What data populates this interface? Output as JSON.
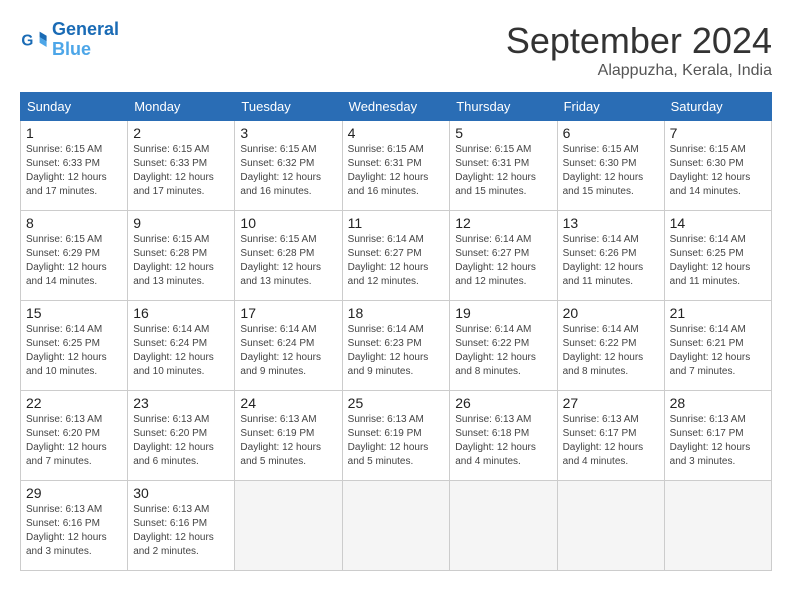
{
  "header": {
    "logo_line1": "General",
    "logo_line2": "Blue",
    "month": "September 2024",
    "location": "Alappuzha, Kerala, India"
  },
  "weekdays": [
    "Sunday",
    "Monday",
    "Tuesday",
    "Wednesday",
    "Thursday",
    "Friday",
    "Saturday"
  ],
  "weeks": [
    [
      {
        "day": "1",
        "info": "Sunrise: 6:15 AM\nSunset: 6:33 PM\nDaylight: 12 hours\nand 17 minutes."
      },
      {
        "day": "2",
        "info": "Sunrise: 6:15 AM\nSunset: 6:33 PM\nDaylight: 12 hours\nand 17 minutes."
      },
      {
        "day": "3",
        "info": "Sunrise: 6:15 AM\nSunset: 6:32 PM\nDaylight: 12 hours\nand 16 minutes."
      },
      {
        "day": "4",
        "info": "Sunrise: 6:15 AM\nSunset: 6:31 PM\nDaylight: 12 hours\nand 16 minutes."
      },
      {
        "day": "5",
        "info": "Sunrise: 6:15 AM\nSunset: 6:31 PM\nDaylight: 12 hours\nand 15 minutes."
      },
      {
        "day": "6",
        "info": "Sunrise: 6:15 AM\nSunset: 6:30 PM\nDaylight: 12 hours\nand 15 minutes."
      },
      {
        "day": "7",
        "info": "Sunrise: 6:15 AM\nSunset: 6:30 PM\nDaylight: 12 hours\nand 14 minutes."
      }
    ],
    [
      {
        "day": "8",
        "info": "Sunrise: 6:15 AM\nSunset: 6:29 PM\nDaylight: 12 hours\nand 14 minutes."
      },
      {
        "day": "9",
        "info": "Sunrise: 6:15 AM\nSunset: 6:28 PM\nDaylight: 12 hours\nand 13 minutes."
      },
      {
        "day": "10",
        "info": "Sunrise: 6:15 AM\nSunset: 6:28 PM\nDaylight: 12 hours\nand 13 minutes."
      },
      {
        "day": "11",
        "info": "Sunrise: 6:14 AM\nSunset: 6:27 PM\nDaylight: 12 hours\nand 12 minutes."
      },
      {
        "day": "12",
        "info": "Sunrise: 6:14 AM\nSunset: 6:27 PM\nDaylight: 12 hours\nand 12 minutes."
      },
      {
        "day": "13",
        "info": "Sunrise: 6:14 AM\nSunset: 6:26 PM\nDaylight: 12 hours\nand 11 minutes."
      },
      {
        "day": "14",
        "info": "Sunrise: 6:14 AM\nSunset: 6:25 PM\nDaylight: 12 hours\nand 11 minutes."
      }
    ],
    [
      {
        "day": "15",
        "info": "Sunrise: 6:14 AM\nSunset: 6:25 PM\nDaylight: 12 hours\nand 10 minutes."
      },
      {
        "day": "16",
        "info": "Sunrise: 6:14 AM\nSunset: 6:24 PM\nDaylight: 12 hours\nand 10 minutes."
      },
      {
        "day": "17",
        "info": "Sunrise: 6:14 AM\nSunset: 6:24 PM\nDaylight: 12 hours\nand 9 minutes."
      },
      {
        "day": "18",
        "info": "Sunrise: 6:14 AM\nSunset: 6:23 PM\nDaylight: 12 hours\nand 9 minutes."
      },
      {
        "day": "19",
        "info": "Sunrise: 6:14 AM\nSunset: 6:22 PM\nDaylight: 12 hours\nand 8 minutes."
      },
      {
        "day": "20",
        "info": "Sunrise: 6:14 AM\nSunset: 6:22 PM\nDaylight: 12 hours\nand 8 minutes."
      },
      {
        "day": "21",
        "info": "Sunrise: 6:14 AM\nSunset: 6:21 PM\nDaylight: 12 hours\nand 7 minutes."
      }
    ],
    [
      {
        "day": "22",
        "info": "Sunrise: 6:13 AM\nSunset: 6:20 PM\nDaylight: 12 hours\nand 7 minutes."
      },
      {
        "day": "23",
        "info": "Sunrise: 6:13 AM\nSunset: 6:20 PM\nDaylight: 12 hours\nand 6 minutes."
      },
      {
        "day": "24",
        "info": "Sunrise: 6:13 AM\nSunset: 6:19 PM\nDaylight: 12 hours\nand 5 minutes."
      },
      {
        "day": "25",
        "info": "Sunrise: 6:13 AM\nSunset: 6:19 PM\nDaylight: 12 hours\nand 5 minutes."
      },
      {
        "day": "26",
        "info": "Sunrise: 6:13 AM\nSunset: 6:18 PM\nDaylight: 12 hours\nand 4 minutes."
      },
      {
        "day": "27",
        "info": "Sunrise: 6:13 AM\nSunset: 6:17 PM\nDaylight: 12 hours\nand 4 minutes."
      },
      {
        "day": "28",
        "info": "Sunrise: 6:13 AM\nSunset: 6:17 PM\nDaylight: 12 hours\nand 3 minutes."
      }
    ],
    [
      {
        "day": "29",
        "info": "Sunrise: 6:13 AM\nSunset: 6:16 PM\nDaylight: 12 hours\nand 3 minutes."
      },
      {
        "day": "30",
        "info": "Sunrise: 6:13 AM\nSunset: 6:16 PM\nDaylight: 12 hours\nand 2 minutes."
      },
      null,
      null,
      null,
      null,
      null
    ]
  ]
}
